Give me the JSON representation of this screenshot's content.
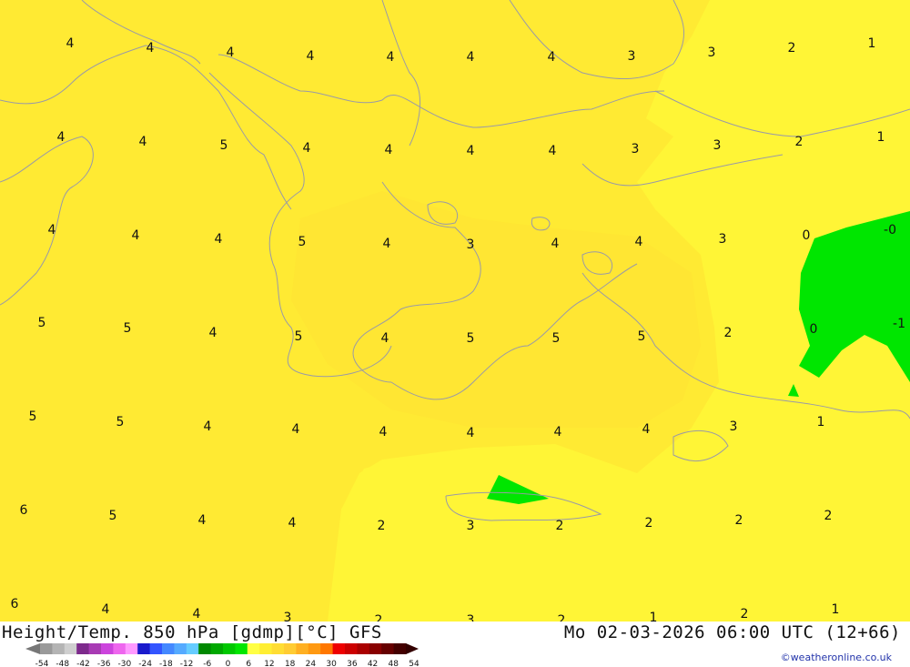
{
  "map": {
    "title": "Height/Temp. 850 hPa [gdmp][°C] GFS",
    "datetime": "Mo 02-03-2026 06:00 UTC (12+66)",
    "credit": "©weatheronline.co.uk",
    "colors": {
      "warm_pale": "#fff536",
      "warm_mid": "#ffea33",
      "warm_dark": "#ffe033",
      "cold": "#00e600",
      "coast": "#9a9aa6"
    },
    "isoline_labels": [
      {
        "text": "4"
      },
      {
        "text": "4"
      },
      {
        "text": "4"
      },
      {
        "text": "4"
      },
      {
        "text": "4"
      },
      {
        "text": "4"
      },
      {
        "text": "4"
      },
      {
        "text": "3"
      },
      {
        "text": "3"
      },
      {
        "text": "2"
      },
      {
        "text": "1"
      },
      {
        "text": "4"
      },
      {
        "text": "4"
      },
      {
        "text": "5"
      },
      {
        "text": "4"
      },
      {
        "text": "4"
      },
      {
        "text": "4"
      },
      {
        "text": "4"
      },
      {
        "text": "3"
      },
      {
        "text": "3"
      },
      {
        "text": "2"
      },
      {
        "text": "1"
      },
      {
        "text": "4"
      },
      {
        "text": "4"
      },
      {
        "text": "4"
      },
      {
        "text": "5"
      },
      {
        "text": "4"
      },
      {
        "text": "3"
      },
      {
        "text": "4"
      },
      {
        "text": "4"
      },
      {
        "text": "3"
      },
      {
        "text": "0"
      },
      {
        "text": "-0"
      },
      {
        "text": "5"
      },
      {
        "text": "5"
      },
      {
        "text": "4"
      },
      {
        "text": "5"
      },
      {
        "text": "4"
      },
      {
        "text": "5"
      },
      {
        "text": "5"
      },
      {
        "text": "5"
      },
      {
        "text": "2"
      },
      {
        "text": "0"
      },
      {
        "text": "-1"
      },
      {
        "text": "5"
      },
      {
        "text": "5"
      },
      {
        "text": "4"
      },
      {
        "text": "4"
      },
      {
        "text": "4"
      },
      {
        "text": "4"
      },
      {
        "text": "4"
      },
      {
        "text": "4"
      },
      {
        "text": "3"
      },
      {
        "text": "1"
      },
      {
        "text": "6"
      },
      {
        "text": "5"
      },
      {
        "text": "4"
      },
      {
        "text": "4"
      },
      {
        "text": "2"
      },
      {
        "text": "3"
      },
      {
        "text": "2"
      },
      {
        "text": "2"
      },
      {
        "text": "2"
      },
      {
        "text": "2"
      },
      {
        "text": "6"
      },
      {
        "text": "4"
      },
      {
        "text": "4"
      },
      {
        "text": "3"
      },
      {
        "text": "2"
      },
      {
        "text": "3"
      },
      {
        "text": "2"
      },
      {
        "text": "1"
      },
      {
        "text": "2"
      },
      {
        "text": "1"
      }
    ]
  },
  "legend": {
    "ticks": [
      "-54",
      "-48",
      "-42",
      "-36",
      "-30",
      "-24",
      "-18",
      "-12",
      "-6",
      "0",
      "6",
      "12",
      "18",
      "24",
      "30",
      "36",
      "42",
      "48",
      "54"
    ],
    "colors": [
      "#9a9a9a",
      "#b4b4b4",
      "#cfcfcf",
      "#7d2a8c",
      "#a83bb4",
      "#cc44dd",
      "#ee66ee",
      "#ff99ff",
      "#1a1acc",
      "#3355ff",
      "#4488ff",
      "#55aaff",
      "#66ccff",
      "#008800",
      "#00a800",
      "#00c800",
      "#00e600",
      "#ffff44",
      "#ffee33",
      "#ffdd33",
      "#ffcc33",
      "#ffb022",
      "#ff9911",
      "#ff7700",
      "#ee0000",
      "#cc0000",
      "#aa0000",
      "#880000",
      "#660000",
      "#440000"
    ]
  }
}
